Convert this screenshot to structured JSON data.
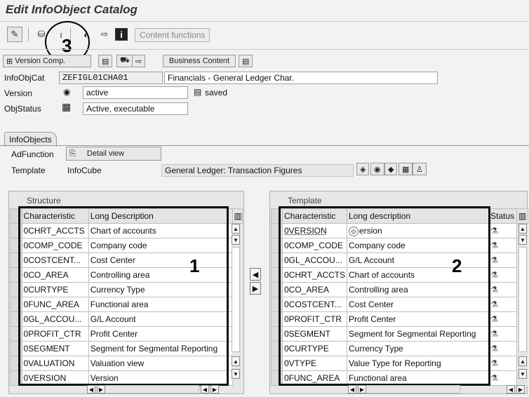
{
  "window": {
    "title": "Edit InfoObject Catalog"
  },
  "toolbar": {
    "content_functions_label": "Content functions",
    "icons": [
      "toggle-display-change-icon",
      "check-icon",
      "activate-icon",
      "copy-icon",
      "navigate-icon",
      "info-icon"
    ]
  },
  "callouts": {
    "c1": "1",
    "c2": "2",
    "c3": "3"
  },
  "subtoolbar": {
    "version_comp_label": "Version Comp.",
    "business_content_label": "Business Content"
  },
  "header": {
    "infoobjcat_label": "InfoObjCat",
    "infoobjcat_value": "ZEFIGL01CHA01",
    "infoobjcat_desc": "Financials - General Ledger Char.",
    "version_label": "Version",
    "version_value": "active",
    "version_status": "saved",
    "objstatus_label": "ObjStatus",
    "objstatus_value": "Active, executable"
  },
  "infoobjects": {
    "tab_label": "InfoObjects",
    "adfunction_label": "AdFunction",
    "detail_view_label": "Detail view",
    "template_label": "Template",
    "template_type": "InfoCube",
    "template_value": "General Ledger: Transaction Figures"
  },
  "structure": {
    "title": "Structure",
    "col1": "Characteristic",
    "col2": "Long Description",
    "rows": [
      {
        "c": "0CHRT_ACCTS",
        "d": "Chart of accounts"
      },
      {
        "c": "0COMP_CODE",
        "d": "Company code"
      },
      {
        "c": "0COSTCENT...",
        "d": "Cost Center"
      },
      {
        "c": "0CO_AREA",
        "d": "Controlling area"
      },
      {
        "c": "0CURTYPE",
        "d": "Currency Type"
      },
      {
        "c": "0FUNC_AREA",
        "d": "Functional area"
      },
      {
        "c": "0GL_ACCOU...",
        "d": "G/L Account"
      },
      {
        "c": "0PROFIT_CTR",
        "d": "Profit Center"
      },
      {
        "c": "0SEGMENT",
        "d": "Segment for Segmental Reporting"
      },
      {
        "c": "0VALUATION",
        "d": "Valuation view"
      },
      {
        "c": "0VERSION",
        "d": "Version"
      }
    ]
  },
  "template_grid": {
    "title": "Template",
    "col1": "Characteristic",
    "col2": "Long description",
    "col3": "Status",
    "rows": [
      {
        "c": "0VERSION",
        "d": "ersion"
      },
      {
        "c": "0COMP_CODE",
        "d": "Company code"
      },
      {
        "c": "0GL_ACCOU...",
        "d": "G/L Account"
      },
      {
        "c": "0CHRT_ACCTS",
        "d": "Chart of accounts"
      },
      {
        "c": "0CO_AREA",
        "d": "Controlling area"
      },
      {
        "c": "0COSTCENT...",
        "d": "Cost Center"
      },
      {
        "c": "0PROFIT_CTR",
        "d": "Profit Center"
      },
      {
        "c": "0SEGMENT",
        "d": "Segment for Segmental Reporting"
      },
      {
        "c": "0CURTYPE",
        "d": "Currency Type"
      },
      {
        "c": "0VTYPE",
        "d": "Value Type for Reporting"
      },
      {
        "c": "0FUNC_AREA",
        "d": "Functional area"
      }
    ]
  }
}
